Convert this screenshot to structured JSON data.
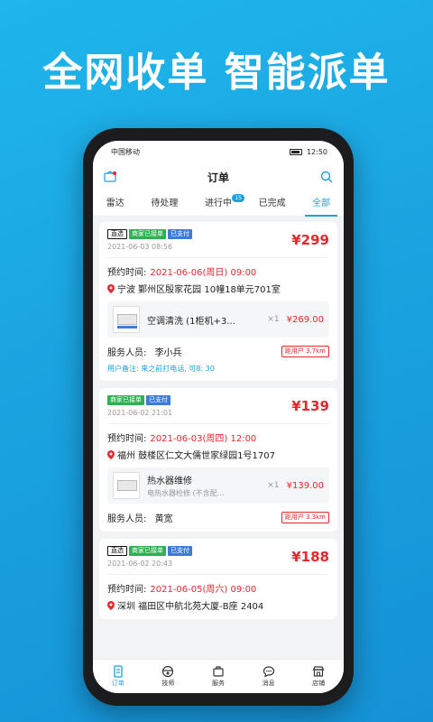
{
  "headline": "全网收单 智能派单",
  "status": {
    "carrier": "中国移动",
    "time": "12:50"
  },
  "nav": {
    "title": "订单"
  },
  "tabs": [
    {
      "label": "雷达"
    },
    {
      "label": "待处理"
    },
    {
      "label": "进行中",
      "badge": "15"
    },
    {
      "label": "已完成"
    },
    {
      "label": "全部",
      "active": true
    }
  ],
  "labels": {
    "appointment": "预约时间:",
    "staff": "服务人员:"
  },
  "orders": [
    {
      "tags": [
        "直选",
        "商家已接单",
        "已支付"
      ],
      "date": "2021-06-03 08:56",
      "price": "¥299",
      "appointment": "2021-06-06(周日) 09:00",
      "address": "宁波 鄞州区殷家花园 10幢18单元701室",
      "product": {
        "name": "空调清洗 (1柜机+3…",
        "sub": "",
        "qty": "×1",
        "price": "¥269.00"
      },
      "staff": "李小兵",
      "distance": "距用户  3.7km",
      "note": "用户备注: 来之前打电话, 可8: 30"
    },
    {
      "tags": [
        "商家已接单",
        "已支付"
      ],
      "date": "2021-06-02 21:01",
      "price": "¥139",
      "appointment": "2021-06-03(周四) 12:00",
      "address": "福州 鼓楼区仁文大儒世家绿园1号1707",
      "product": {
        "name": "热水器维修",
        "sub": "电热水器检修 (不含配…",
        "qty": "×1",
        "price": "¥139.00"
      },
      "staff": "黄宽",
      "distance": "距用户  3.3km",
      "note": ""
    },
    {
      "tags": [
        "直选",
        "商家已接单",
        "已支付"
      ],
      "date": "2021-06-02 20:43",
      "price": "¥188",
      "appointment": "2021-06-05(周六) 09:00",
      "address": "深圳 福田区中航北苑大厦-B座 2404"
    }
  ],
  "bottom_nav": [
    {
      "label": "订单",
      "icon": "order-icon",
      "active": true
    },
    {
      "label": "技师",
      "icon": "technician-icon"
    },
    {
      "label": "服务",
      "icon": "service-icon"
    },
    {
      "label": "消息",
      "icon": "message-icon"
    },
    {
      "label": "店铺",
      "icon": "store-icon"
    }
  ],
  "colors": {
    "accent": "#1a9fe0",
    "price": "#e8262b",
    "tag_green": "#2eb152",
    "tag_blue": "#3d7bd9"
  }
}
